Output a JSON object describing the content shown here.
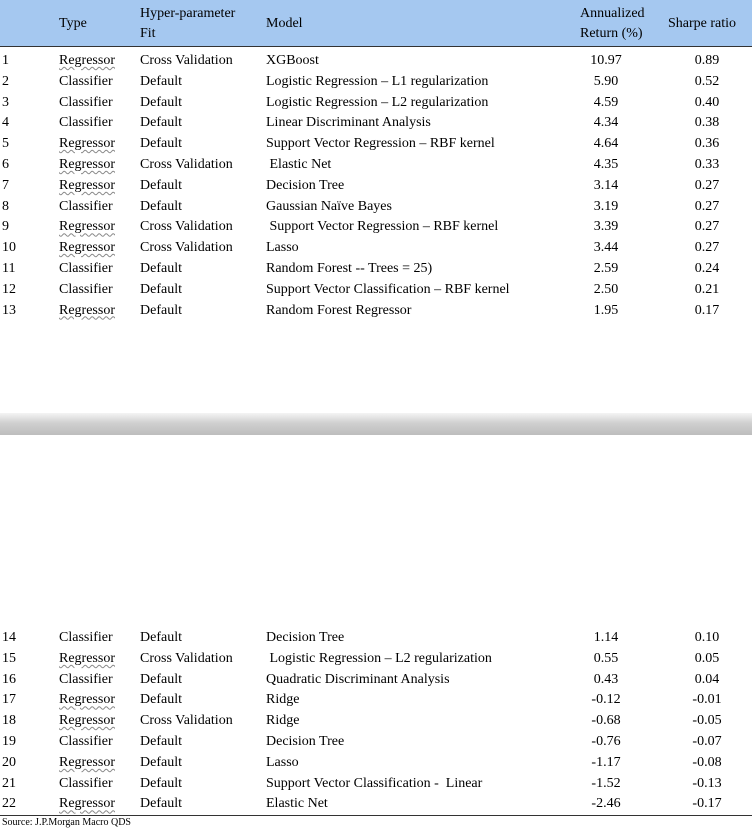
{
  "header": {
    "type": "Type",
    "fit_line1": "Hyper-parameter",
    "fit_line2": "Fit",
    "model": "Model",
    "return_line1": "Annualized",
    "return_line2": "Return (%)",
    "sharpe": "Sharpe ratio"
  },
  "rows_top": [
    {
      "num": "1",
      "type": "Regressor",
      "fit": "Cross Validation",
      "model": "XGBoost",
      "ret": "10.97",
      "sr": "0.89"
    },
    {
      "num": "2",
      "type": "Classifier",
      "fit": "Default",
      "model": "Logistic Regression – L1 regularization",
      "ret": "5.90",
      "sr": "0.52"
    },
    {
      "num": "3",
      "type": "Classifier",
      "fit": "Default",
      "model": "Logistic Regression – L2 regularization",
      "ret": "4.59",
      "sr": "0.40"
    },
    {
      "num": "4",
      "type": "Classifier",
      "fit": "Default",
      "model": "Linear Discriminant Analysis",
      "ret": "4.34",
      "sr": "0.38"
    },
    {
      "num": "5",
      "type": "Regressor",
      "fit": "Default",
      "model": "Support Vector Regression – RBF kernel",
      "ret": "4.64",
      "sr": "0.36"
    },
    {
      "num": "6",
      "type": "Regressor",
      "fit": "Cross Validation",
      "model": " Elastic Net",
      "ret": "4.35",
      "sr": "0.33"
    },
    {
      "num": "7",
      "type": "Regressor",
      "fit": "Default",
      "model": "Decision Tree",
      "ret": "3.14",
      "sr": "0.27"
    },
    {
      "num": "8",
      "type": "Classifier",
      "fit": "Default",
      "model": "Gaussian Naïve Bayes",
      "ret": "3.19",
      "sr": "0.27"
    },
    {
      "num": "9",
      "type": "Regressor",
      "fit": "Cross Validation",
      "model": " Support Vector Regression – RBF kernel",
      "ret": "3.39",
      "sr": "0.27"
    },
    {
      "num": "10",
      "type": "Regressor",
      "fit": "Cross Validation",
      "model": "Lasso",
      "ret": "3.44",
      "sr": "0.27"
    },
    {
      "num": "11",
      "type": "Classifier",
      "fit": "Default",
      "model": "Random Forest -- Trees = 25)",
      "ret": "2.59",
      "sr": "0.24"
    },
    {
      "num": "12",
      "type": "Classifier",
      "fit": "Default",
      "model": "Support Vector Classification – RBF kernel",
      "ret": "2.50",
      "sr": "0.21"
    },
    {
      "num": "13",
      "type": "Regressor",
      "fit": "Default",
      "model": "Random Forest Regressor",
      "ret": "1.95",
      "sr": "0.17"
    }
  ],
  "rows_bottom": [
    {
      "num": "14",
      "type": "Classifier",
      "fit": "Default",
      "model": "Decision Tree",
      "ret": "1.14",
      "sr": "0.10"
    },
    {
      "num": "15",
      "type": "Regressor",
      "fit": "Cross Validation",
      "model": " Logistic Regression – L2 regularization",
      "ret": "0.55",
      "sr": "0.05"
    },
    {
      "num": "16",
      "type": "Classifier",
      "fit": "Default",
      "model": "Quadratic Discriminant Analysis",
      "ret": "0.43",
      "sr": "0.04"
    },
    {
      "num": "17",
      "type": "Regressor",
      "fit": "Default",
      "model": "Ridge",
      "ret": "-0.12",
      "sr": "-0.01"
    },
    {
      "num": "18",
      "type": "Regressor",
      "fit": "Cross Validation",
      "model": "Ridge",
      "ret": "-0.68",
      "sr": "-0.05"
    },
    {
      "num": "19",
      "type": "Classifier",
      "fit": "Default",
      "model": "Decision Tree",
      "ret": "-0.76",
      "sr": "-0.07"
    },
    {
      "num": "20",
      "type": "Regressor",
      "fit": "Default",
      "model": "Lasso",
      "ret": "-1.17",
      "sr": "-0.08"
    },
    {
      "num": "21",
      "type": "Classifier",
      "fit": "Default",
      "model": "Support Vector Classification -  Linear",
      "ret": "-1.52",
      "sr": "-0.13"
    },
    {
      "num": "22",
      "type": "Regressor",
      "fit": "Default",
      "model": "Elastic Net",
      "ret": "-2.46",
      "sr": "-0.17"
    }
  ],
  "source": "Source: J.P.Morgan Macro QDS",
  "colors": {
    "header_bg": "#a5c8f0"
  }
}
